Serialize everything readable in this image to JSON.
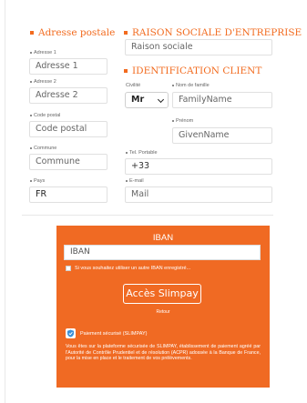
{
  "postal": {
    "title": "Adresse postale",
    "fields": [
      {
        "label": "Adresse 1",
        "placeholder": "Adresse 1"
      },
      {
        "label": "Adresse 2",
        "placeholder": "Adresse 2"
      },
      {
        "label": "Code postal",
        "placeholder": "Code postal"
      },
      {
        "label": "Commune",
        "placeholder": "Commune"
      },
      {
        "label": "Pays",
        "value": "FR"
      }
    ]
  },
  "company": {
    "title": "RAISON SOCIALE D'ENTREPRISE",
    "placeholder": "Raison sociale"
  },
  "client": {
    "title": "IDENTIFICATION CLIENT",
    "civility_label": "Civilité",
    "civility_value": "Mr",
    "lastname_label": "Nom de famille",
    "lastname_placeholder": "FamilyName",
    "firstname_label": "Prénom",
    "firstname_placeholder": "GivenName",
    "phone_label": "Tel. Portable",
    "phone_value": "+33",
    "email_label": "E-mail",
    "email_placeholder": "Mail"
  },
  "iban": {
    "title": "IBAN",
    "placeholder": "IBAN",
    "checkbox_label": "Si vous souhaitez utiliser un autre IBAN enregistré...",
    "button_label": "Accès Slimpay",
    "back_label": "Retour",
    "secure_label": "Paiement sécurisé (SLIMPAY)",
    "notice": "Vous êtes sur la plateforme sécurisée de SLIMPAY, établissement de paiement agréé par l'Autorité de Contrôle Prudentiel et de résolution (ACPR) adossée à la Banque de France, pour la mise en place et le traitement de vos prélèvements."
  },
  "colors": {
    "accent": "#f06a23",
    "title": "#f26b1f"
  }
}
